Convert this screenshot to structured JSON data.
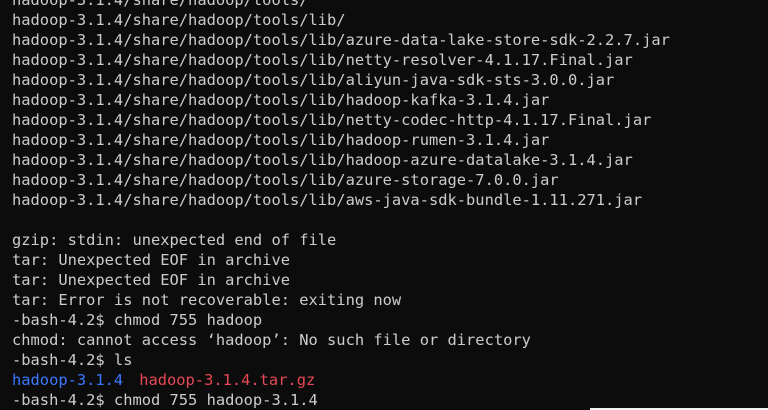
{
  "terminal": {
    "listing": [
      "hadoop-3.1.4/share/hadoop/tools/",
      "hadoop-3.1.4/share/hadoop/tools/lib/",
      "hadoop-3.1.4/share/hadoop/tools/lib/azure-data-lake-store-sdk-2.2.7.jar",
      "hadoop-3.1.4/share/hadoop/tools/lib/netty-resolver-4.1.17.Final.jar",
      "hadoop-3.1.4/share/hadoop/tools/lib/aliyun-java-sdk-sts-3.0.0.jar",
      "hadoop-3.1.4/share/hadoop/tools/lib/hadoop-kafka-3.1.4.jar",
      "hadoop-3.1.4/share/hadoop/tools/lib/netty-codec-http-4.1.17.Final.jar",
      "hadoop-3.1.4/share/hadoop/tools/lib/hadoop-rumen-3.1.4.jar",
      "hadoop-3.1.4/share/hadoop/tools/lib/hadoop-azure-datalake-3.1.4.jar",
      "hadoop-3.1.4/share/hadoop/tools/lib/azure-storage-7.0.0.jar",
      "hadoop-3.1.4/share/hadoop/tools/lib/aws-java-sdk-bundle-1.11.271.jar"
    ],
    "errors": [
      "gzip: stdin: unexpected end of file",
      "tar: Unexpected EOF in archive",
      "tar: Unexpected EOF in archive",
      "tar: Error is not recoverable: exiting now"
    ],
    "cmd1": "-bash-4.2$ chmod 755 hadoop",
    "cmd1_output": "chmod: cannot access ‘hadoop’: No such file or directory",
    "cmd2": "-bash-4.2$ ls",
    "ls_output": {
      "dir_name": "hadoop-3.1.4",
      "archive_name": "hadoop-3.1.4.tar.gz"
    },
    "cmd3": "-bash-4.2$ chmod 755 hadoop-3.1.4"
  },
  "colors": {
    "background": "#0c0c0c",
    "text": "#cccccc",
    "directory": "#3b78ff",
    "archive": "#e74856"
  }
}
